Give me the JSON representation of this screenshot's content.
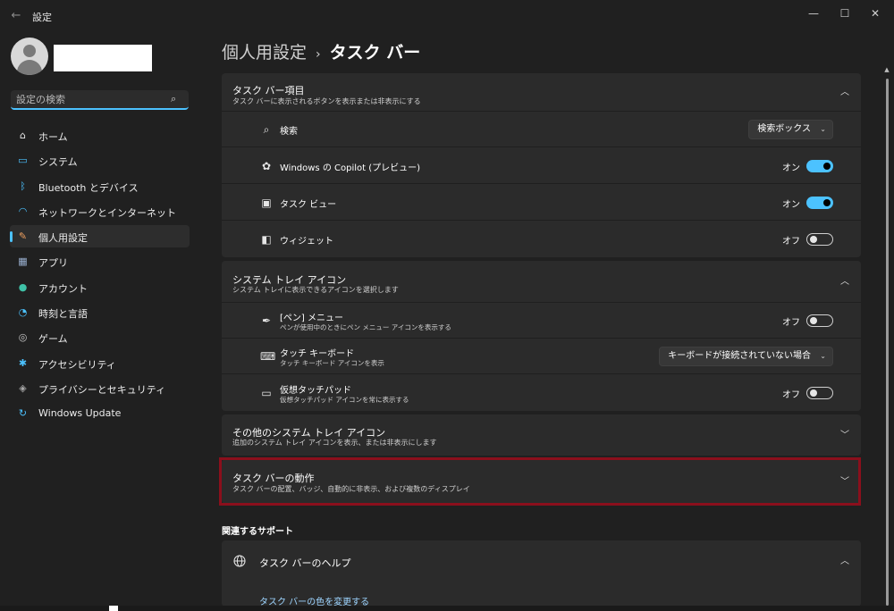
{
  "window": {
    "title": "設定",
    "back_icon": "←",
    "controls": {
      "minimize": "—",
      "maximize": "☐",
      "close": "✕"
    }
  },
  "search": {
    "placeholder": "設定の検索",
    "icon": "⌕"
  },
  "sidebar": {
    "items": [
      {
        "label": "ホーム",
        "icon": "home-icon",
        "glyph": "⌂",
        "color": "#e8e8e8",
        "active": false
      },
      {
        "label": "システム",
        "icon": "monitor-icon",
        "glyph": "▭",
        "color": "#4cc2ff",
        "active": false
      },
      {
        "label": "Bluetooth とデバイス",
        "icon": "bluetooth-icon",
        "glyph": "ᛒ",
        "color": "#4cc2ff",
        "active": false
      },
      {
        "label": "ネットワークとインターネット",
        "icon": "wifi-icon",
        "glyph": "◠",
        "color": "#4cc2ff",
        "active": false
      },
      {
        "label": "個人用設定",
        "icon": "brush-icon",
        "glyph": "✎",
        "color": "#f0a060",
        "active": true
      },
      {
        "label": "アプリ",
        "icon": "apps-icon",
        "glyph": "▦",
        "color": "#9ab0d0",
        "active": false
      },
      {
        "label": "アカウント",
        "icon": "account-icon",
        "glyph": "●",
        "color": "#3fc1a7",
        "active": false
      },
      {
        "label": "時刻と言語",
        "icon": "globe-clock-icon",
        "glyph": "◔",
        "color": "#4cc2ff",
        "active": false
      },
      {
        "label": "ゲーム",
        "icon": "gamepad-icon",
        "glyph": "◎",
        "color": "#c8c8c8",
        "active": false
      },
      {
        "label": "アクセシビリティ",
        "icon": "accessibility-icon",
        "glyph": "✱",
        "color": "#4cc2ff",
        "active": false
      },
      {
        "label": "プライバシーとセキュリティ",
        "icon": "shield-icon",
        "glyph": "◈",
        "color": "#a8a8a8",
        "active": false
      },
      {
        "label": "Windows Update",
        "icon": "update-icon",
        "glyph": "↻",
        "color": "#4cc2ff",
        "active": false
      }
    ]
  },
  "breadcrumb": {
    "parent": "個人用設定",
    "separator": "›",
    "current": "タスク バー"
  },
  "taskbar_items": {
    "title": "タスク バー項目",
    "subtitle": "タスク バーに表示されるボタンを表示または非表示にする",
    "rows": [
      {
        "label": "検索",
        "icon": "search-icon",
        "glyph": "⌕",
        "control": "dropdown",
        "value": "検索ボックス"
      },
      {
        "label": "Windows の Copilot (プレビュー)",
        "icon": "copilot-icon",
        "glyph": "✿",
        "control": "toggle",
        "state": "オン",
        "on": true
      },
      {
        "label": "タスク ビュー",
        "icon": "task-view-icon",
        "glyph": "▣",
        "control": "toggle",
        "state": "オン",
        "on": true
      },
      {
        "label": "ウィジェット",
        "icon": "widgets-icon",
        "glyph": "◧",
        "control": "toggle",
        "state": "オフ",
        "on": false
      }
    ]
  },
  "system_tray": {
    "title": "システム トレイ アイコン",
    "subtitle": "システム トレイに表示できるアイコンを選択します",
    "rows": [
      {
        "label": "[ペン] メニュー",
        "sub": "ペンが使用中のときにペン メニュー アイコンを表示する",
        "icon": "pen-icon",
        "glyph": "✒",
        "control": "toggle",
        "state": "オフ",
        "on": false
      },
      {
        "label": "タッチ キーボード",
        "sub": "タッチ キーボード アイコンを表示",
        "icon": "keyboard-icon",
        "glyph": "⌨",
        "control": "dropdown",
        "value": "キーボードが接続されていない場合"
      },
      {
        "label": "仮想タッチパッド",
        "sub": "仮想タッチパッド アイコンを常に表示する",
        "icon": "touchpad-icon",
        "glyph": "▭",
        "control": "toggle",
        "state": "オフ",
        "on": false
      }
    ]
  },
  "other_tray": {
    "title": "その他のシステム トレイ アイコン",
    "subtitle": "追加のシステム トレイ アイコンを表示、または非表示にします"
  },
  "behaviors": {
    "title": "タスク バーの動作",
    "subtitle": "タスク バーの配置、バッジ、自動的に非表示、および複数のディスプレイ"
  },
  "related": {
    "heading": "関連するサポート",
    "help_title": "タスク バーのヘルプ",
    "help_icon": "globe-icon",
    "link": "タスク バーの色を変更する"
  },
  "chevrons": {
    "up": "︿",
    "down": "﹀",
    "dd": "⌄"
  }
}
